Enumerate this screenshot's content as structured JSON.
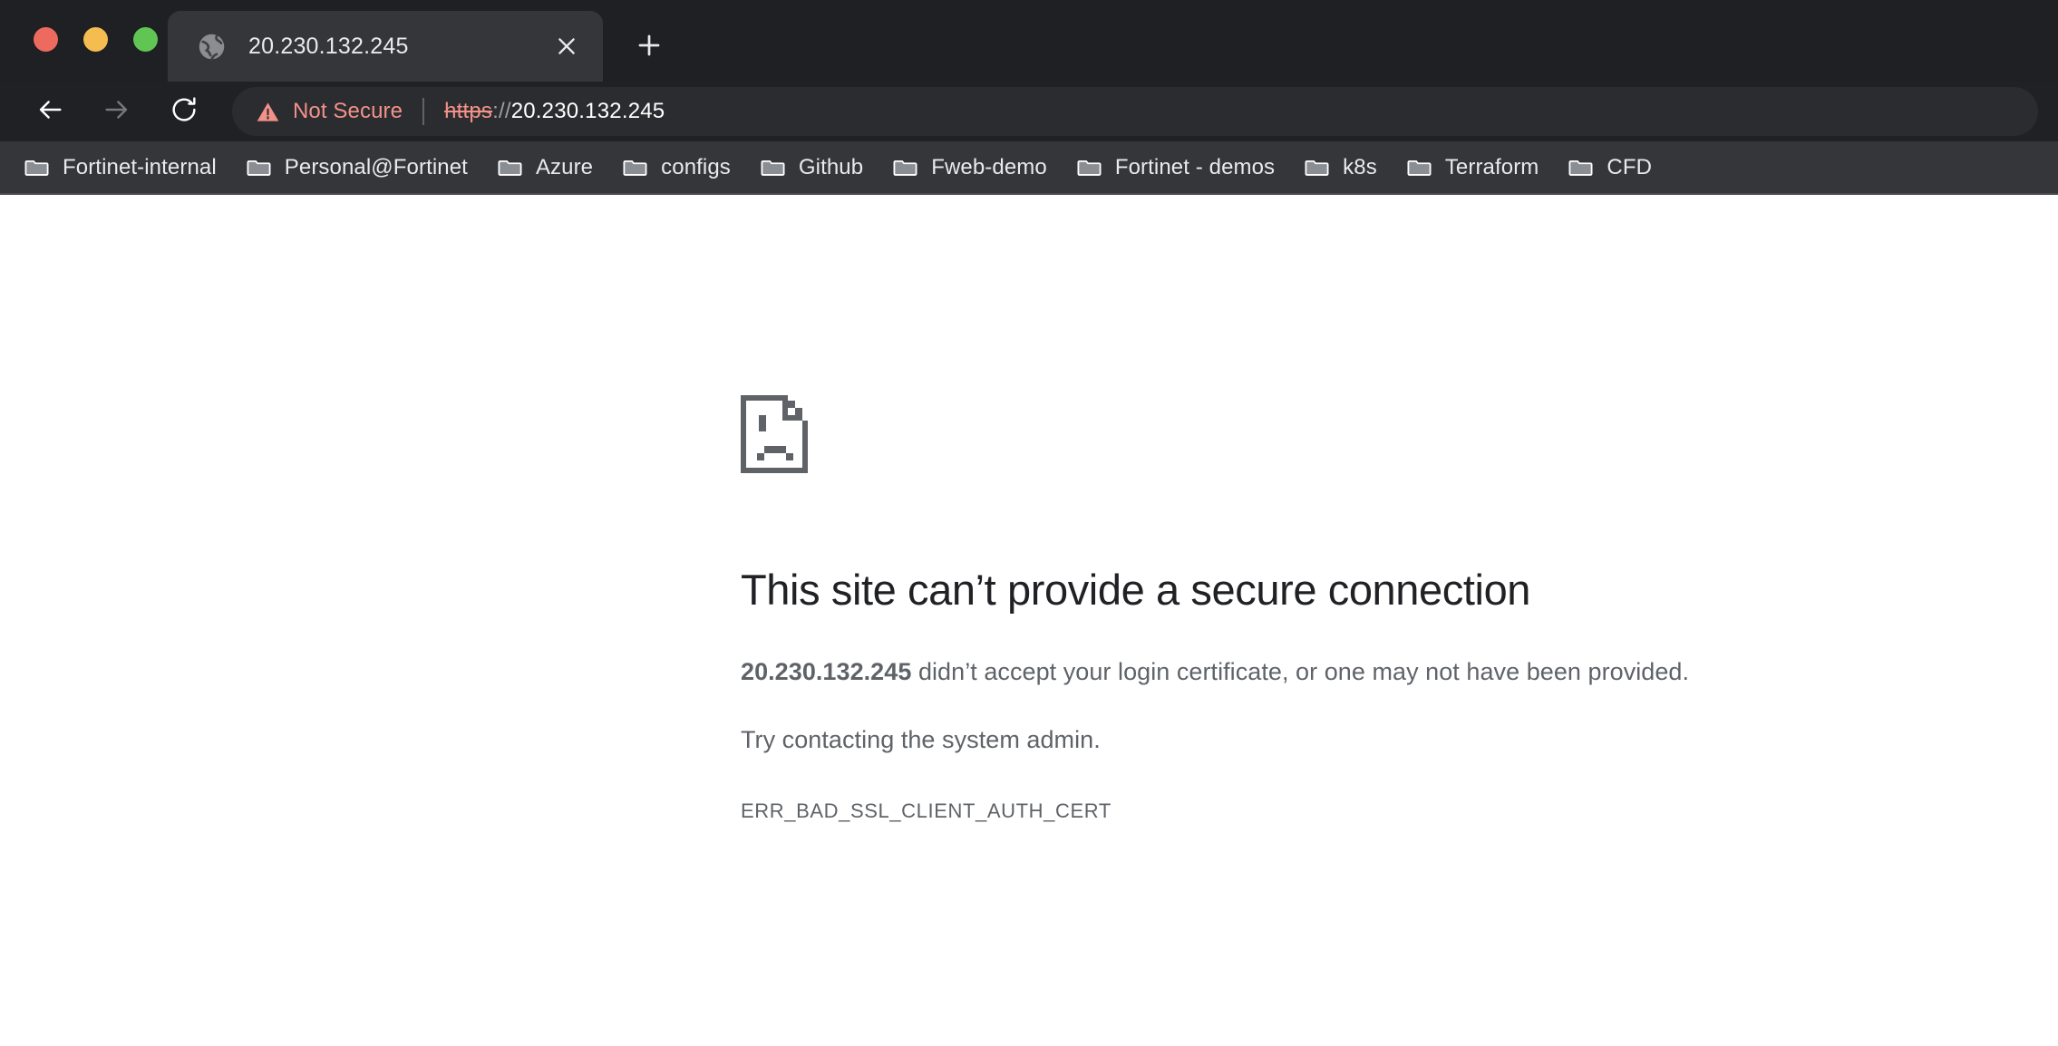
{
  "window": {
    "controls": [
      {
        "name": "close",
        "color": "#ed6a5e"
      },
      {
        "name": "minimize",
        "color": "#f5bd4f"
      },
      {
        "name": "maximize",
        "color": "#61c554"
      }
    ]
  },
  "tabstrip": {
    "tab": {
      "favicon": "globe-icon",
      "title": "20.230.132.245",
      "close_icon": "close-icon"
    },
    "new_tab_icon": "plus-icon"
  },
  "toolbar": {
    "back_icon": "arrow-left-icon",
    "forward_icon": "arrow-right-icon",
    "reload_icon": "reload-icon",
    "security": {
      "icon": "warning-triangle-icon",
      "label": "Not Secure",
      "color": "#f2918a"
    },
    "url": {
      "scheme": "https",
      "separator": "://",
      "host": "20.230.132.245"
    }
  },
  "bookmarks": {
    "folder_icon": "folder-icon",
    "items": [
      {
        "label": "Fortinet-internal"
      },
      {
        "label": "Personal@Fortinet"
      },
      {
        "label": "Azure"
      },
      {
        "label": "configs"
      },
      {
        "label": "Github"
      },
      {
        "label": "Fweb-demo"
      },
      {
        "label": "Fortinet - demos"
      },
      {
        "label": "k8s"
      },
      {
        "label": "Terraform"
      },
      {
        "label": "CFD"
      }
    ]
  },
  "page": {
    "icon": "sad-page-icon",
    "headline": "This site can’t provide a secure connection",
    "paragraph_host": "20.230.132.245",
    "paragraph_rest": " didn’t accept your login certificate, or one may not have been provided.",
    "suggestion": "Try contacting the system admin.",
    "error_code": "ERR_BAD_SSL_CLIENT_AUTH_CERT"
  }
}
